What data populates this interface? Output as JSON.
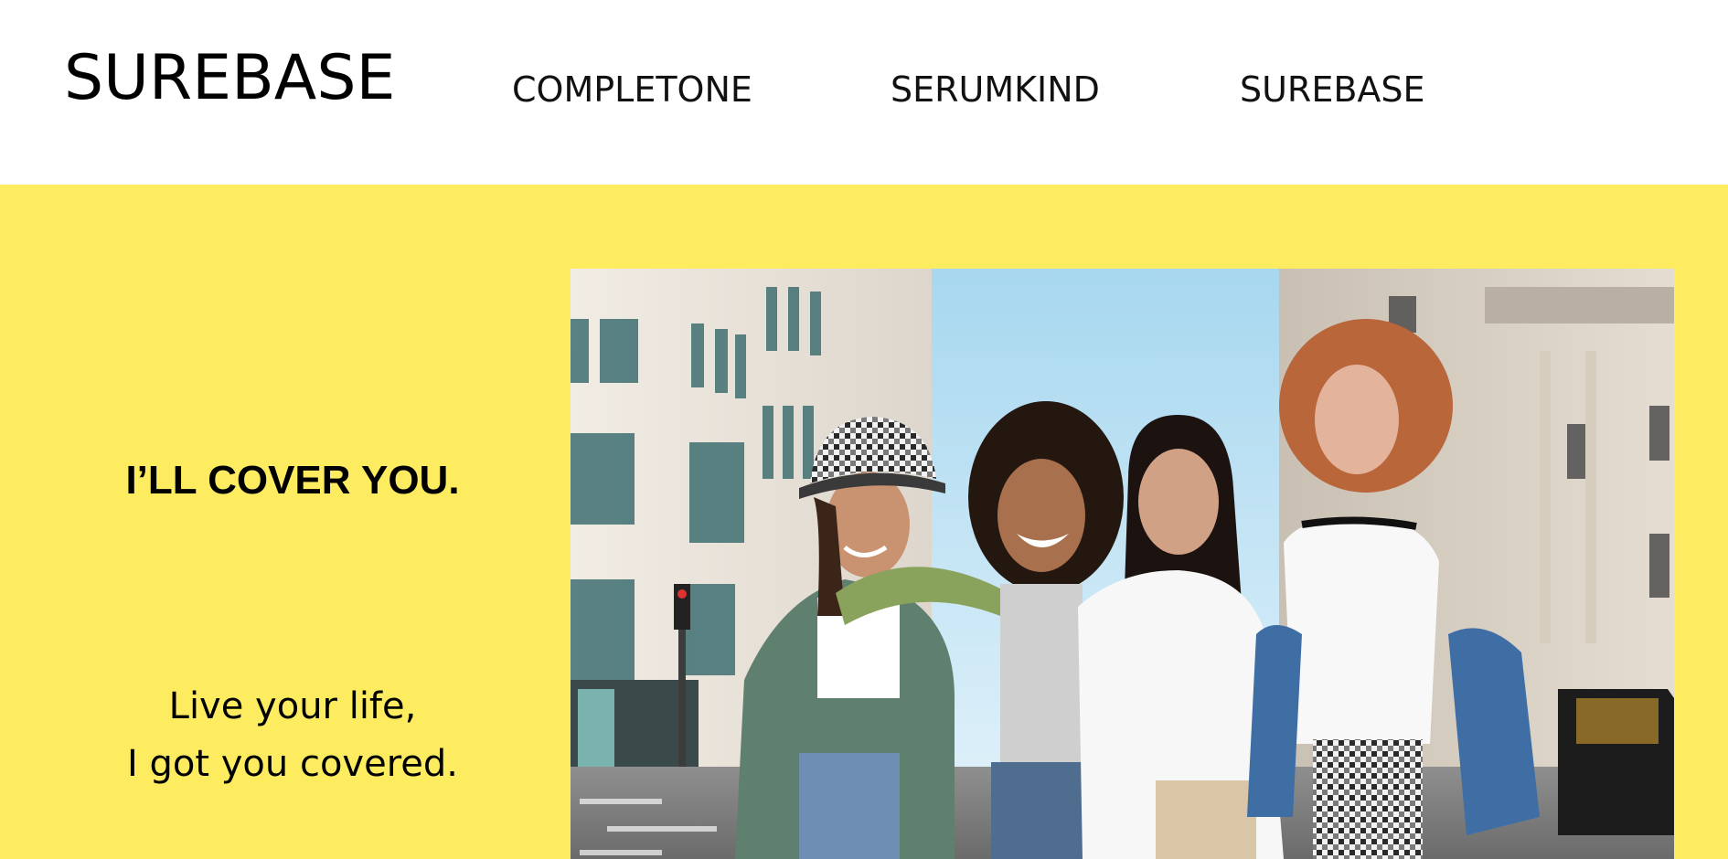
{
  "header": {
    "logo": "SUREBASE",
    "nav": [
      {
        "label": "COMPLETONE"
      },
      {
        "label": "SERUMKIND"
      },
      {
        "label": "SUREBASE"
      }
    ]
  },
  "hero": {
    "background_color": "#FEEC60",
    "headline": "I’LL COVER YOU.",
    "tagline_lines": [
      "Live your life,",
      "I got you covered."
    ],
    "image_alt": "group-of-four-friends-on-city-street"
  }
}
